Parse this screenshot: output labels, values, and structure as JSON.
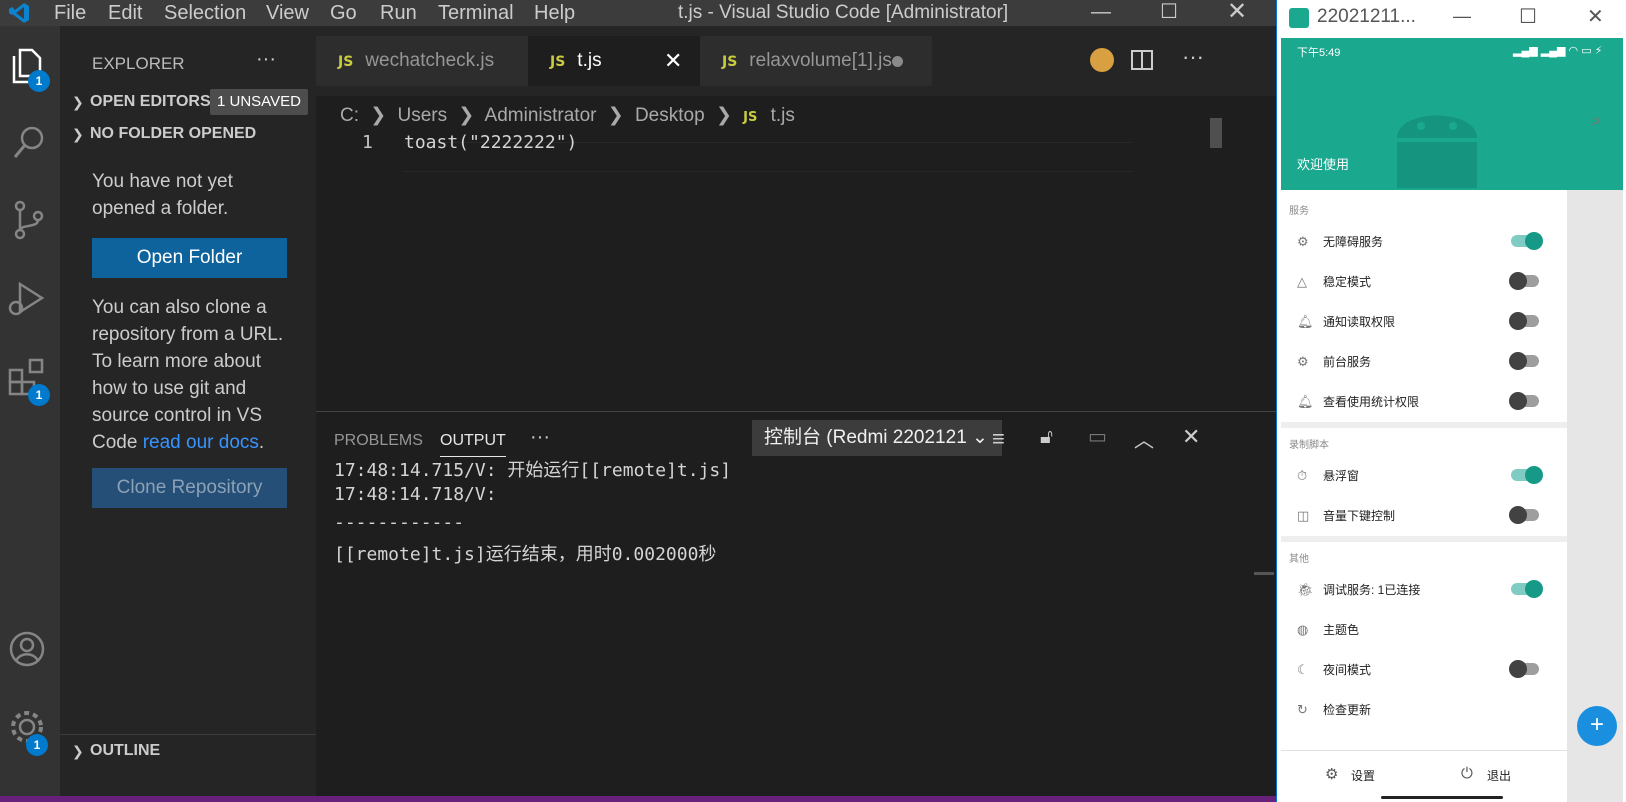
{
  "vscode": {
    "menu": [
      "File",
      "Edit",
      "Selection",
      "View",
      "Go",
      "Run",
      "Terminal",
      "Help"
    ],
    "window_title": "t.js - Visual Studio Code [Administrator]",
    "activity_badges": {
      "explorer": "1",
      "extensions": "1",
      "settings": "1"
    },
    "sidebar": {
      "title": "EXPLORER",
      "open_editors": "OPEN EDITORS",
      "unsaved_badge": "1 UNSAVED",
      "no_folder": "NO FOLDER OPENED",
      "not_opened_text": "You have not yet opened a folder.",
      "open_folder_button": "Open Folder",
      "clone_text_1": "You can also clone a repository from a URL. To learn more about how to use git and source control in VS Code ",
      "clone_link": "read our docs",
      "clone_text_end": ".",
      "clone_button": "Clone Repository",
      "outline": "OUTLINE"
    },
    "tabs": [
      {
        "label": "wechatcheck.js",
        "active": false,
        "dirty": false
      },
      {
        "label": "t.js",
        "active": true,
        "dirty": false
      },
      {
        "label": "relaxvolume[1].js",
        "active": false,
        "dirty": true
      }
    ],
    "breadcrumb": [
      "C:",
      "Users",
      "Administrator",
      "Desktop",
      "t.js"
    ],
    "code": {
      "line_number": "1",
      "text": "toast(\"2222222\")"
    },
    "panel": {
      "tabs": [
        "PROBLEMS",
        "OUTPUT"
      ],
      "more": "···",
      "output_channel": "控制台 (Redmi 2202121",
      "lines": [
        "17:48:14.715/V: 开始运行[[remote]t.js]",
        "17:48:14.718/V:",
        "------------",
        "[[remote]t.js]运行结束，用时0.002000秒"
      ]
    }
  },
  "phone": {
    "window_title": "22021211...",
    "status_time": "下午5:49",
    "welcome": "欢迎使用",
    "groups": [
      {
        "title": "服务",
        "items": [
          {
            "label": "无障碍服务",
            "icon": "gears-icon",
            "on": true
          },
          {
            "label": "稳定模式",
            "icon": "triangle-icon",
            "on": false
          },
          {
            "label": "通知读取权限",
            "icon": "bell-icon",
            "on": false
          },
          {
            "label": "前台服务",
            "icon": "gears-icon",
            "on": false
          },
          {
            "label": "查看使用统计权限",
            "icon": "bell-icon",
            "on": false
          }
        ]
      },
      {
        "title": "录制脚本",
        "items": [
          {
            "label": "悬浮窗",
            "icon": "timer-icon",
            "on": true
          },
          {
            "label": "音量下键控制",
            "icon": "vibrate-icon",
            "on": false
          }
        ]
      },
      {
        "title": "其他",
        "items": [
          {
            "label": "调试服务: 1已连接",
            "icon": "bug-icon",
            "on": true
          },
          {
            "label": "主题色",
            "icon": "palette-icon",
            "on": null
          },
          {
            "label": "夜间模式",
            "icon": "moon-icon",
            "on": false
          },
          {
            "label": "检查更新",
            "icon": "refresh-icon",
            "on": null
          }
        ]
      }
    ],
    "bottom": {
      "settings": "设置",
      "exit": "退出"
    },
    "accent": "#1aa88f"
  }
}
